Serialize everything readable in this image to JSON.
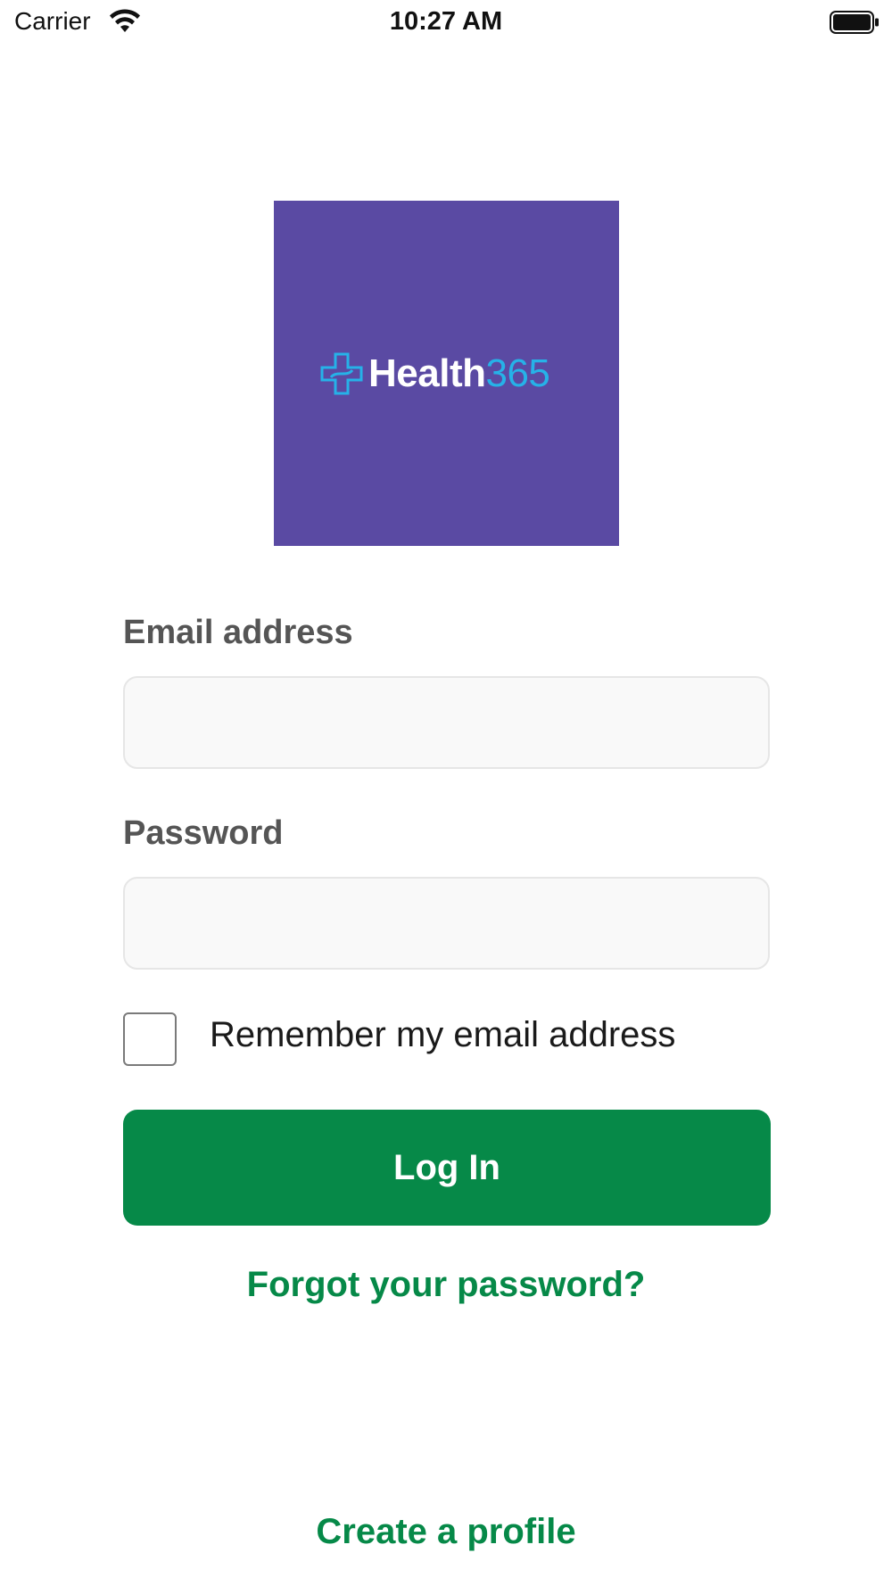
{
  "status_bar": {
    "carrier": "Carrier",
    "time": "10:27 AM",
    "wifi_icon": "wifi-icon",
    "battery_icon": "battery-icon"
  },
  "logo": {
    "brand_word": "Health",
    "brand_number": "365",
    "icon": "medical-cross-icon",
    "background_color": "#5a4aa3",
    "accent_color": "#26b2e8"
  },
  "form": {
    "email_label": "Email address",
    "email_value": "",
    "email_placeholder": "",
    "password_label": "Password",
    "password_value": "",
    "password_placeholder": "",
    "remember_label": "Remember my email address",
    "remember_checked": false,
    "login_button": "Log In",
    "forgot_link": "Forgot your password?",
    "create_link": "Create a profile"
  },
  "colors": {
    "primary_green": "#068948",
    "label_gray": "#555555",
    "input_bg": "#f9f9f9",
    "input_border": "#e6e6e6"
  }
}
